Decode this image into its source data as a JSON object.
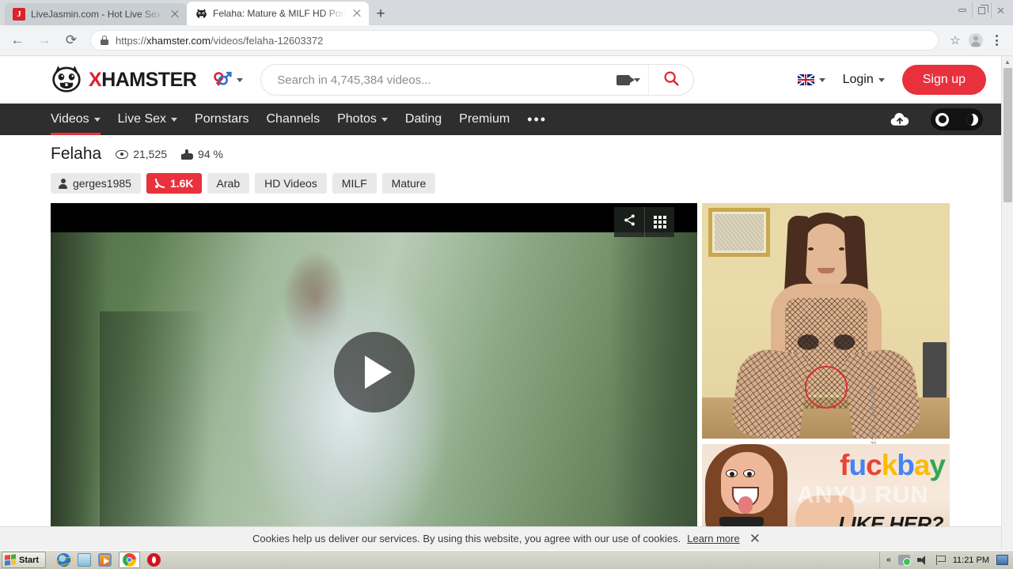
{
  "browser": {
    "tabs": [
      {
        "title": "LiveJasmin.com - Hot Live Sex Show",
        "favicon_letter": "J",
        "active": false
      },
      {
        "title": "Felaha: Mature & MILF HD Porn Vide",
        "favicon_letter": "",
        "active": true
      }
    ],
    "newtab_label": "+",
    "url_scheme": "https://",
    "url_host": "xhamster.com",
    "url_path": "/videos/felaha-12603372",
    "back_label": "←",
    "forward_label": "→",
    "reload_label": "⟳",
    "bookmark_label": "☆",
    "window_controls": {
      "minimize": "–",
      "maximize": "❐",
      "close": "✕"
    }
  },
  "site": {
    "logo": {
      "x": "X",
      "rest": "HAMSTER"
    },
    "search": {
      "placeholder": "Search in 4,745,384 videos...",
      "value": "",
      "category_icon": "video-camera-icon",
      "submit_icon": "search-icon"
    },
    "language": "English (UK)",
    "login_label": "Login",
    "signup_label": "Sign up",
    "nav": [
      {
        "label": "Videos",
        "dropdown": true,
        "active": true
      },
      {
        "label": "Live Sex",
        "dropdown": true,
        "active": false
      },
      {
        "label": "Pornstars",
        "dropdown": false,
        "active": false
      },
      {
        "label": "Channels",
        "dropdown": false,
        "active": false
      },
      {
        "label": "Photos",
        "dropdown": true,
        "active": false
      },
      {
        "label": "Dating",
        "dropdown": false,
        "active": false
      },
      {
        "label": "Premium",
        "dropdown": false,
        "active": false
      }
    ],
    "nav_more": "•••",
    "upload_icon": "upload-cloud-icon",
    "theme_toggle": {
      "light_icon": "sun-icon",
      "dark_icon": "moon-icon",
      "state": "dark"
    }
  },
  "video": {
    "title": "Felaha",
    "views": "21,525",
    "rating": "94 %",
    "uploader": "gerges1985",
    "subscribers": "1.6K",
    "tags": [
      "Arab",
      "HD Videos",
      "MILF",
      "Mature"
    ],
    "player": {
      "share_icon": "share-icon",
      "playlist_icon": "grid-icon",
      "play_icon": "play-icon"
    }
  },
  "ads": {
    "label": "ADS BY TRAFFICSTARS",
    "banner2": {
      "brand_letters": [
        "f",
        "u",
        "c",
        "k",
        "b",
        "a",
        "y"
      ],
      "tagline": "LIKE HER?",
      "watermark": "ANYU   RUN"
    }
  },
  "cookies": {
    "message": "Cookies help us deliver our services. By using this website, you agree with our use of cookies.",
    "link_label": "Learn more",
    "close_label": "✕"
  },
  "taskbar": {
    "start_label": "Start",
    "quick_launch": [
      "internet-explorer-icon",
      "folder-icon",
      "media-player-icon",
      "chrome-icon",
      "opera-icon"
    ],
    "tray": {
      "chevron": "«",
      "time": "11:21 PM"
    }
  }
}
